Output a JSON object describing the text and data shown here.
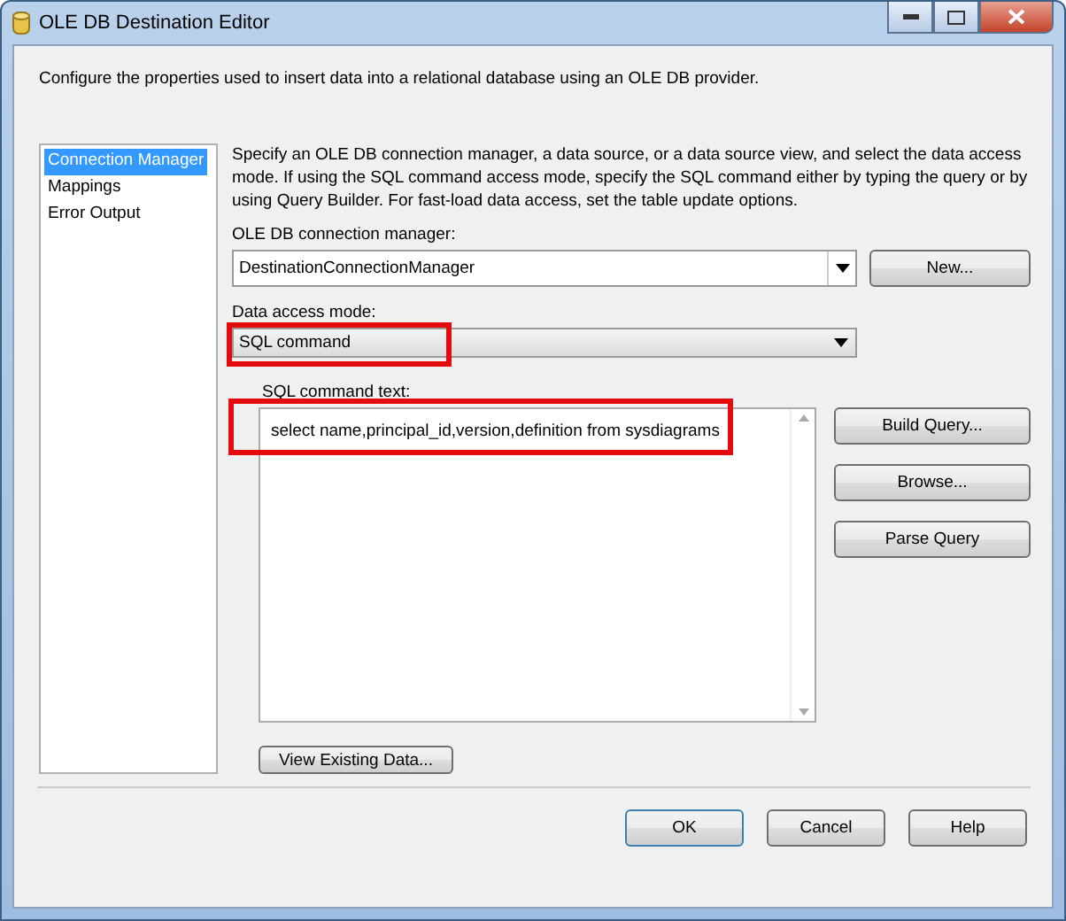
{
  "window": {
    "title": "OLE DB Destination Editor"
  },
  "intro": "Configure the properties used to insert data into a relational database using an OLE DB provider.",
  "sidebar": {
    "items": [
      {
        "label": "Connection Manager",
        "selected": true
      },
      {
        "label": "Mappings",
        "selected": false
      },
      {
        "label": "Error Output",
        "selected": false
      }
    ]
  },
  "description": "Specify an OLE DB connection manager, a data source, or a data source view, and select the data access mode. If using the SQL command access mode, specify the SQL command either by typing the query or by using Query Builder. For fast-load data access, set the table update options.",
  "connection": {
    "label": "OLE DB connection manager:",
    "value": "DestinationConnectionManager",
    "button": "New..."
  },
  "access_mode": {
    "label": "Data access mode:",
    "value": "SQL command",
    "highlighted": true
  },
  "sql": {
    "label": "SQL command text:",
    "value": "select name,principal_id,version,definition from sysdiagrams",
    "highlighted": true,
    "buttons": [
      "Build Query...",
      "Browse...",
      "Parse Query"
    ]
  },
  "view_button": "View Existing Data...",
  "footer_buttons": [
    {
      "label": "OK",
      "default": true
    },
    {
      "label": "Cancel",
      "default": false
    },
    {
      "label": "Help",
      "default": false
    }
  ]
}
